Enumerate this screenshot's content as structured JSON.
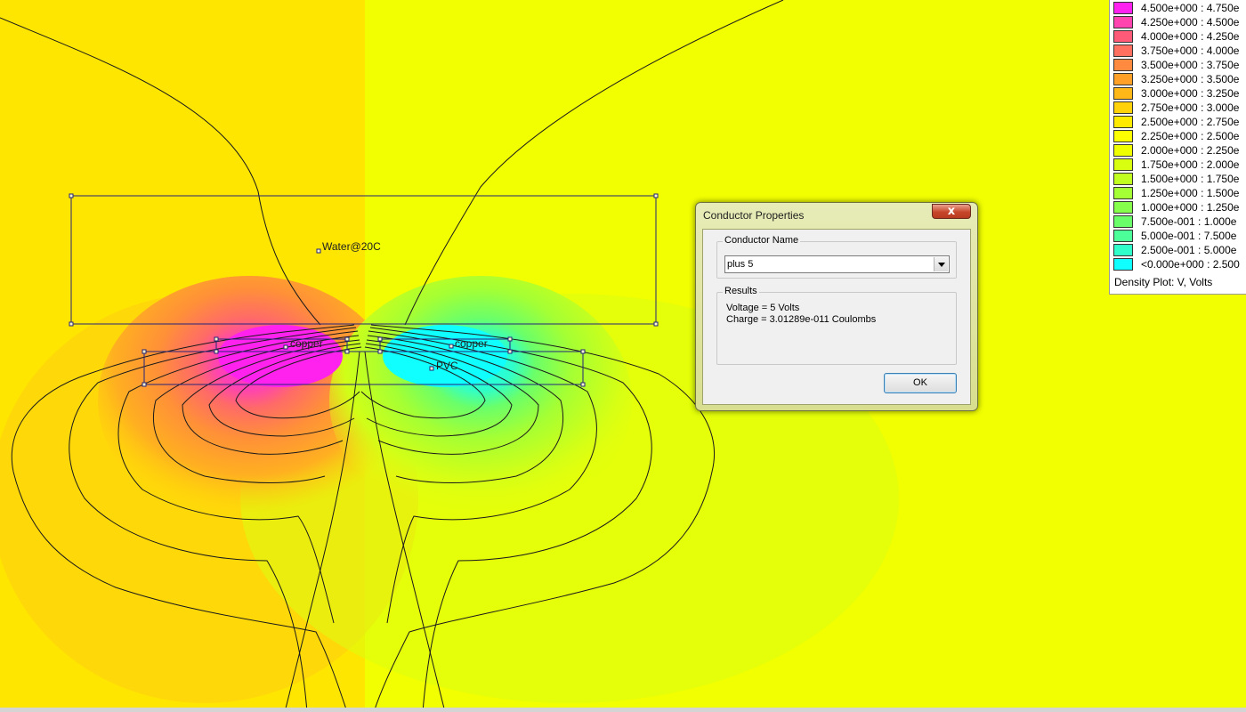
{
  "plot": {
    "labels": {
      "water": "Water@20C",
      "copper_left": "copper",
      "copper_right": "copper",
      "pvc": "PVC"
    }
  },
  "legend": {
    "rows": [
      {
        "range": "4.500e+000 : 4.750e",
        "color": "#ff22ee"
      },
      {
        "range": "4.250e+000 : 4.500e",
        "color": "#ff44b0"
      },
      {
        "range": "4.000e+000 : 4.250e",
        "color": "#ff5a78"
      },
      {
        "range": "3.750e+000 : 4.000e",
        "color": "#ff7060"
      },
      {
        "range": "3.500e+000 : 3.750e",
        "color": "#ff8a40"
      },
      {
        "range": "3.250e+000 : 3.500e",
        "color": "#ffa028"
      },
      {
        "range": "3.000e+000 : 3.250e",
        "color": "#ffb818"
      },
      {
        "range": "2.750e+000 : 3.000e",
        "color": "#ffd20a"
      },
      {
        "range": "2.500e+000 : 2.750e",
        "color": "#ffea00"
      },
      {
        "range": "2.250e+000 : 2.500e",
        "color": "#fdff00"
      },
      {
        "range": "2.000e+000 : 2.250e",
        "color": "#f0ff00"
      },
      {
        "range": "1.750e+000 : 2.000e",
        "color": "#d8ff10"
      },
      {
        "range": "1.500e+000 : 1.750e",
        "color": "#c0ff20"
      },
      {
        "range": "1.250e+000 : 1.500e",
        "color": "#a4ff34"
      },
      {
        "range": "1.000e+000 : 1.250e",
        "color": "#86ff4c"
      },
      {
        "range": "7.500e-001 : 1.000e",
        "color": "#6aff6a"
      },
      {
        "range": "5.000e-001 : 7.500e",
        "color": "#4cff98"
      },
      {
        "range": "2.500e-001 : 5.000e",
        "color": "#30ffca"
      },
      {
        "range": "<0.000e+000 : 2.500",
        "color": "#10ffff"
      }
    ],
    "title": "Density Plot: V, Volts"
  },
  "dialog": {
    "title": "Conductor Properties",
    "close_glyph": "x",
    "name_group_label": "Conductor Name",
    "conductor_name": "plus 5",
    "results_group_label": "Results",
    "voltage_line": "Voltage = 5 Volts",
    "charge_line": "Charge = 3.01289e-011 Coulombs",
    "ok_label": "OK"
  }
}
